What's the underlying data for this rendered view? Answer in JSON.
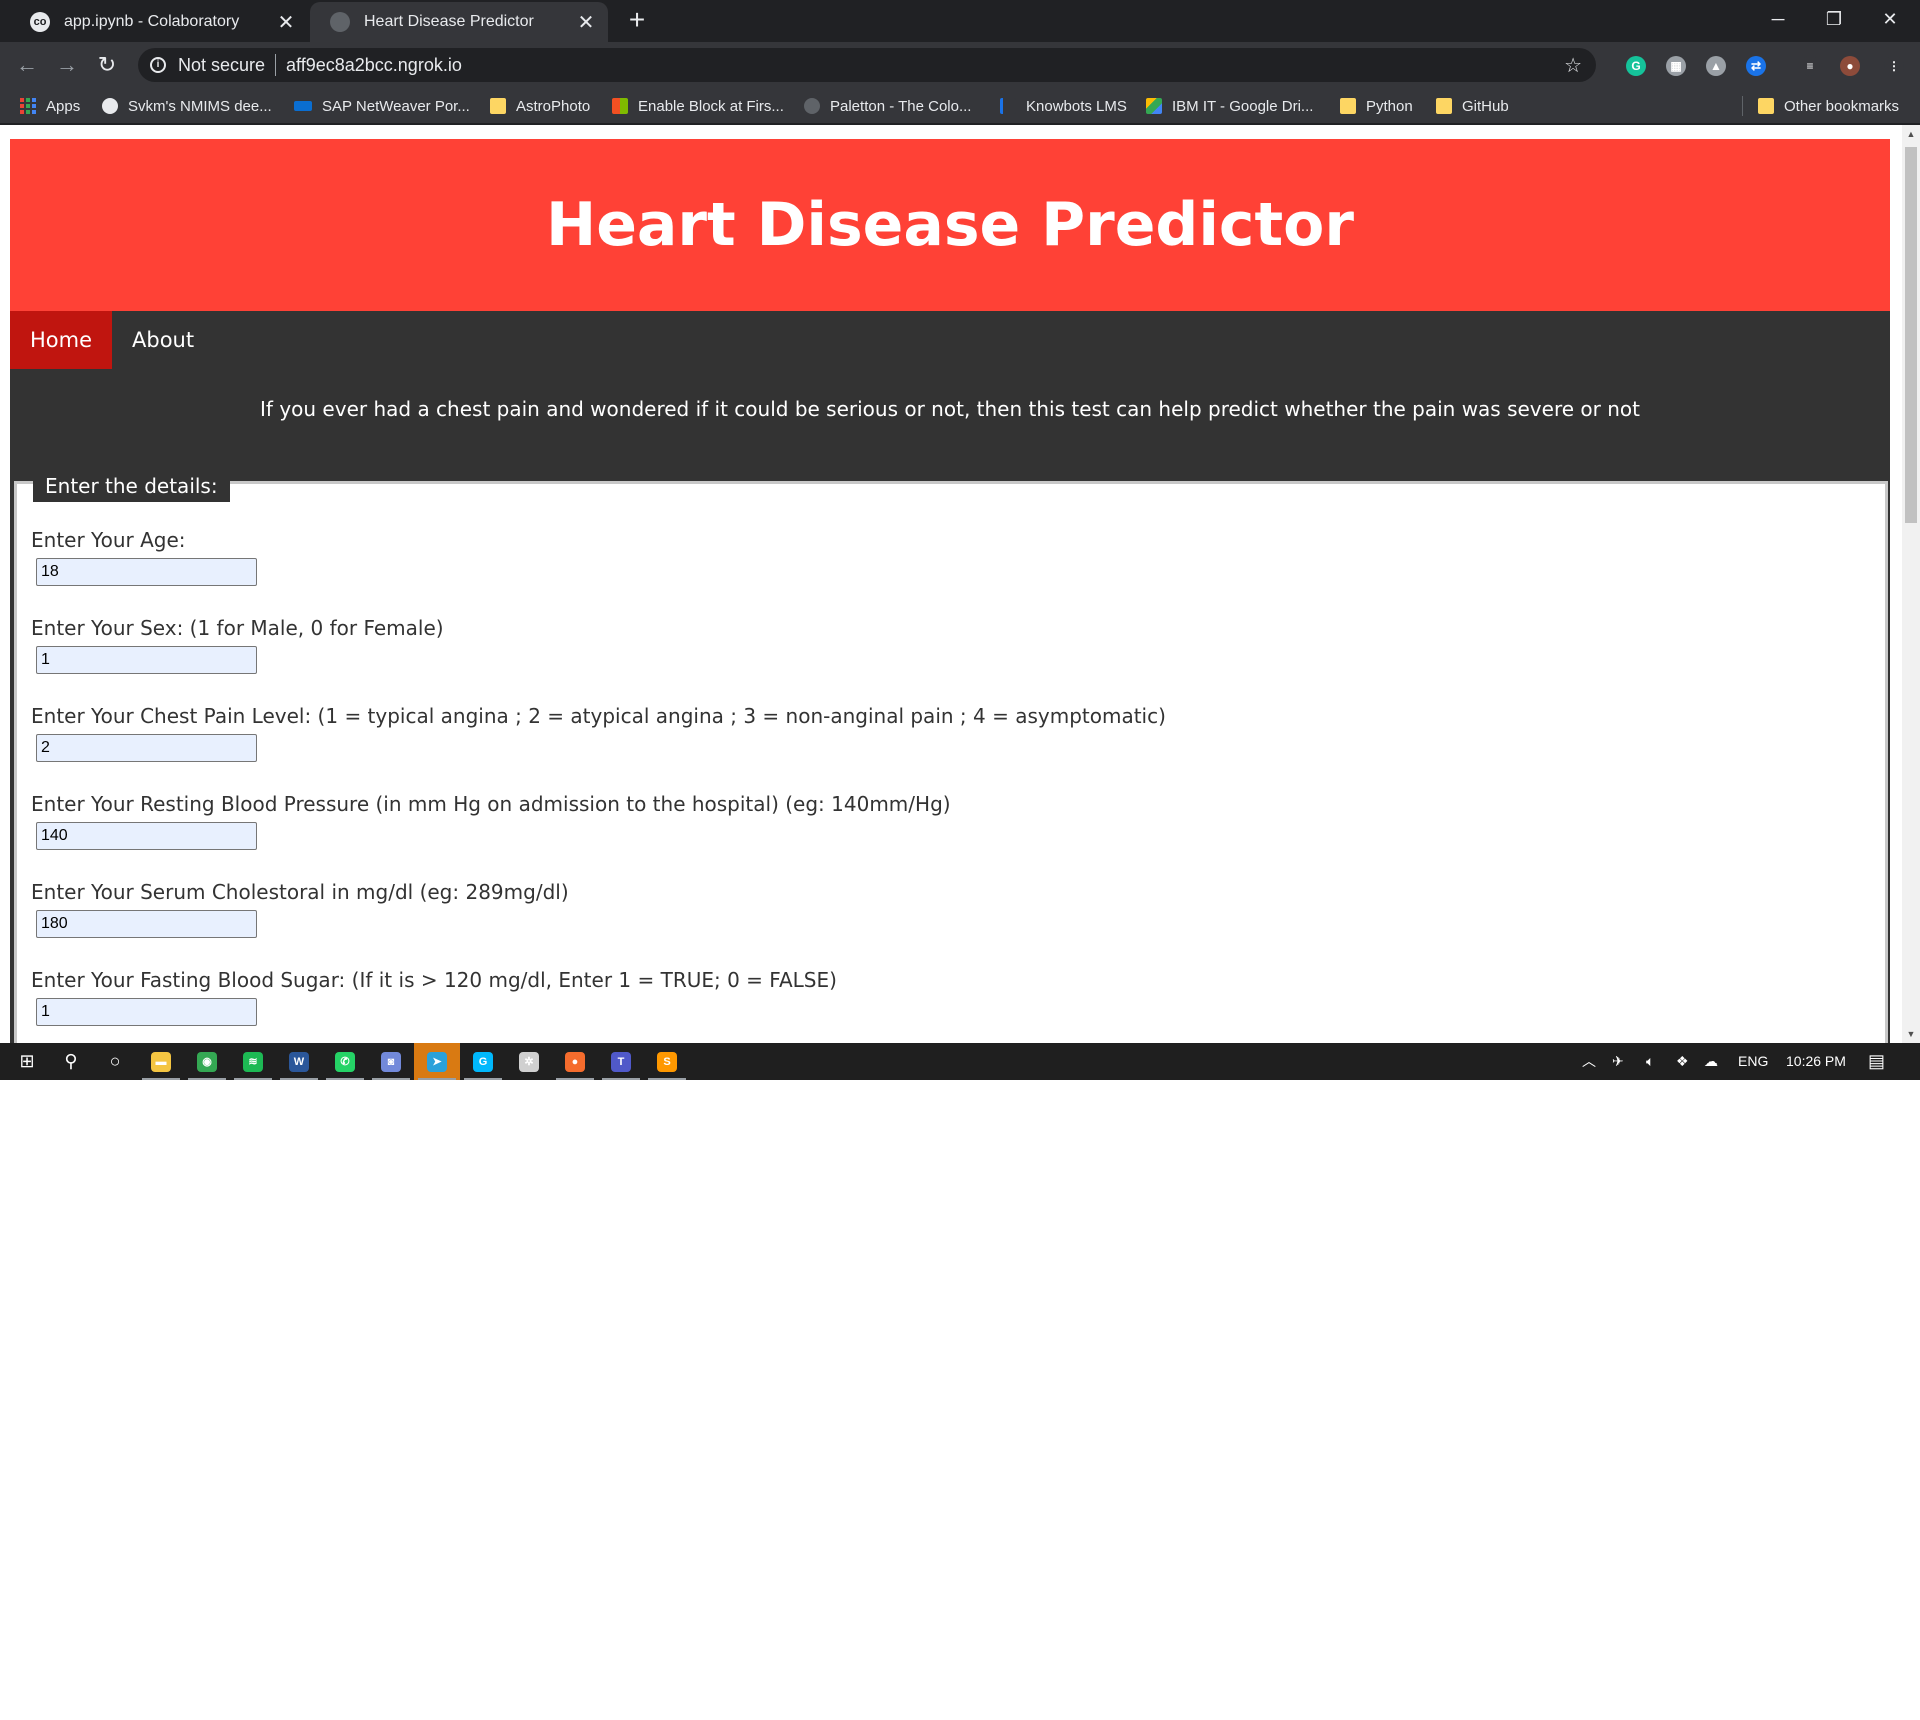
{
  "browser": {
    "tabs": [
      {
        "title": "app.ipynb - Colaboratory",
        "favicon": "co",
        "close": "✕"
      },
      {
        "title": "Heart Disease Predictor",
        "favicon": "",
        "close": "✕"
      }
    ],
    "new_tab": "+",
    "window_controls": {
      "minimize": "─",
      "restore": "❐",
      "close": "✕"
    },
    "nav": {
      "back": "←",
      "forward": "→",
      "reload": "↻"
    },
    "omnibox": {
      "info": "i",
      "security": "Not secure",
      "url": "aff9ec8a2bcc.ngrok.io",
      "star": "☆"
    },
    "extensions": [
      {
        "name": "grammarly-icon",
        "glyph": "G",
        "color": "#15c39a"
      },
      {
        "name": "extension-icon",
        "glyph": "▦",
        "color": "#9aa0a6"
      },
      {
        "name": "drive-icon",
        "glyph": "▲",
        "color": "#9aa0a6"
      },
      {
        "name": "sync-icon",
        "glyph": "⇄",
        "color": "#1a73e8"
      },
      {
        "name": "media-icon",
        "glyph": "≡",
        "color": "#35363a"
      },
      {
        "name": "profile-avatar-icon",
        "glyph": "●",
        "color": "#8d4b3a"
      },
      {
        "name": "menu-icon",
        "glyph": "⋮",
        "color": "#35363a"
      }
    ],
    "bookmarks": [
      {
        "label": "Apps",
        "icon": "apps-grid"
      },
      {
        "label": "Svkm's NMIMS dee...",
        "icon": "nmims-icon"
      },
      {
        "label": "SAP NetWeaver Por...",
        "icon": "sap-icon"
      },
      {
        "label": "AstroPhoto",
        "icon": "folder-icon"
      },
      {
        "label": "Enable Block at Firs...",
        "icon": "microsoft-icon"
      },
      {
        "label": "Paletton - The Colo...",
        "icon": "paletton-icon"
      },
      {
        "label": "Knowbots LMS",
        "icon": "knowbots-icon"
      },
      {
        "label": "IBM IT - Google Dri...",
        "icon": "drive-icon"
      },
      {
        "label": "Python",
        "icon": "folder-icon"
      },
      {
        "label": "GitHub",
        "icon": "folder-icon"
      }
    ],
    "other_bookmarks": "Other bookmarks"
  },
  "page": {
    "title": "Heart Disease Predictor",
    "nav": [
      {
        "label": "Home",
        "active": true
      },
      {
        "label": "About",
        "active": false
      }
    ],
    "intro": "If you ever had a chest pain and wondered if it could be serious or not, then this test can help predict whether the pain was severe or not",
    "form": {
      "legend": "Enter the details:",
      "fields": [
        {
          "label": "Enter Your Age:",
          "value": "18"
        },
        {
          "label": "Enter Your Sex: (1 for Male, 0 for Female)",
          "value": "1"
        },
        {
          "label": "Enter Your Chest Pain Level: (1 = typical angina ; 2 = atypical angina ; 3 = non-anginal pain ; 4 = asymptomatic)",
          "value": "2"
        },
        {
          "label": "Enter Your Resting Blood Pressure (in mm Hg on admission to the hospital) (eg: 140mm/Hg)",
          "value": "140"
        },
        {
          "label": "Enter Your Serum Cholestoral in mg/dl (eg: 289mg/dl)",
          "value": "180"
        },
        {
          "label": "Enter Your Fasting Blood Sugar: (If it is > 120 mg/dl, Enter 1 = TRUE; 0 = FALSE)",
          "value": "1"
        }
      ]
    },
    "colors": {
      "header": "#ff4136",
      "nav_active": "#c0150f",
      "body_bg": "#333333"
    }
  },
  "taskbar": {
    "apps": [
      {
        "name": "windows-start-icon",
        "glyph": "⊞"
      },
      {
        "name": "search-icon",
        "glyph": "⚲"
      },
      {
        "name": "cortana-icon",
        "glyph": "○"
      },
      {
        "name": "file-explorer-icon",
        "glyph": "▬",
        "color": "#f4c542"
      },
      {
        "name": "chrome-icon",
        "glyph": "◉",
        "color": "#34a853"
      },
      {
        "name": "spotify-icon",
        "glyph": "≋",
        "color": "#1db954"
      },
      {
        "name": "word-icon",
        "glyph": "W",
        "color": "#2b579a"
      },
      {
        "name": "whatsapp-icon",
        "glyph": "✆",
        "color": "#25d366"
      },
      {
        "name": "discord-icon",
        "glyph": "◙",
        "color": "#7289da"
      },
      {
        "name": "telegram-icon",
        "glyph": "➤",
        "color": "#2aa1da"
      },
      {
        "name": "logitech-icon",
        "glyph": "G",
        "color": "#00b8fc"
      },
      {
        "name": "settings-gear-icon",
        "glyph": "✲",
        "color": "#d0d0d0"
      },
      {
        "name": "origin-icon",
        "glyph": "●",
        "color": "#f56c2d"
      },
      {
        "name": "teams-icon",
        "glyph": "T",
        "color": "#5059c9"
      },
      {
        "name": "sublime-icon",
        "glyph": "S",
        "color": "#ff9800"
      }
    ],
    "tray": {
      "language": "ENG",
      "time": "10:26 PM"
    }
  }
}
